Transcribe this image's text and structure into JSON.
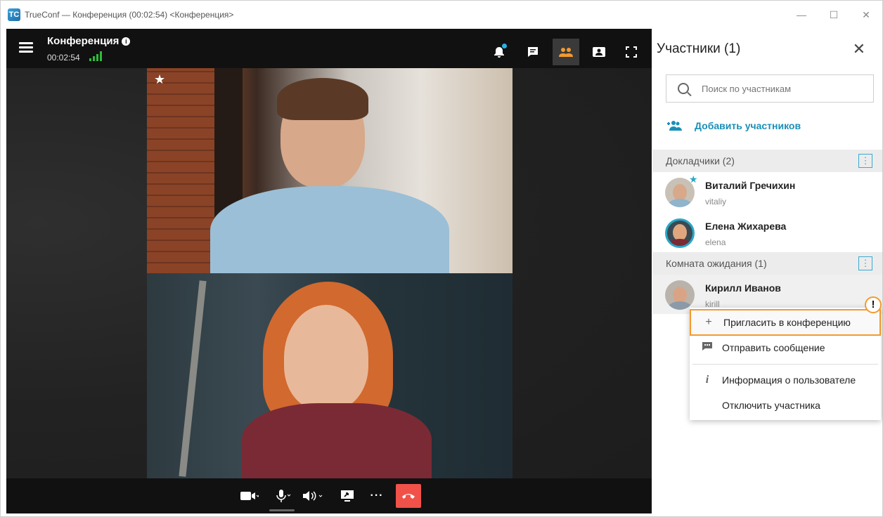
{
  "window": {
    "title": "TrueConf — Конференция (00:02:54) <Конференция>",
    "logo": "TC",
    "minimize": "—",
    "maximize": "☐",
    "close": "✕"
  },
  "conference": {
    "title": "Конференция",
    "info_glyph": "i",
    "elapsed": "00:02:54"
  },
  "toolbar": {
    "icons": [
      "bell-icon",
      "chat-icon",
      "participants-icon",
      "layout-icon",
      "fullscreen-icon"
    ],
    "active": "participants-icon",
    "accent": "#f39a2d"
  },
  "controls": {
    "icons": [
      "camera-icon",
      "microphone-icon",
      "speaker-icon",
      "share-screen-icon",
      "more-icon",
      "hangup-icon"
    ],
    "hangup_color": "#f0524a",
    "more_glyph": "···"
  },
  "sidebar": {
    "title": "Участники (1)",
    "close_glyph": "✕",
    "search_placeholder": "Поиск по участникам",
    "add_label": "Добавить участников",
    "sections": [
      {
        "label": "Докладчики (2)",
        "more_glyph": "⋮",
        "members": [
          {
            "name": "Виталий Гречихин",
            "login": "vitaliy",
            "owner": true
          },
          {
            "name": "Елена Жихарева",
            "login": "elena",
            "owner": false
          }
        ]
      },
      {
        "label": "Комната ожидания (1)",
        "more_glyph": "⋮",
        "members": [
          {
            "name": "Кирилл Иванов",
            "login": "kirill",
            "owner": false
          }
        ]
      }
    ],
    "accent": "#1a8fb8"
  },
  "context_menu": {
    "items": [
      {
        "label": "Пригласить в конференцию",
        "icon": "+",
        "highlighted": true
      },
      {
        "label": "Отправить сообщение",
        "icon": "chat-icon"
      },
      {
        "label": "Информация о пользователе",
        "icon": "i"
      },
      {
        "label": "Отключить участника",
        "icon": ""
      }
    ],
    "highlight_color": "#f39a2d",
    "warning_glyph": "!"
  }
}
